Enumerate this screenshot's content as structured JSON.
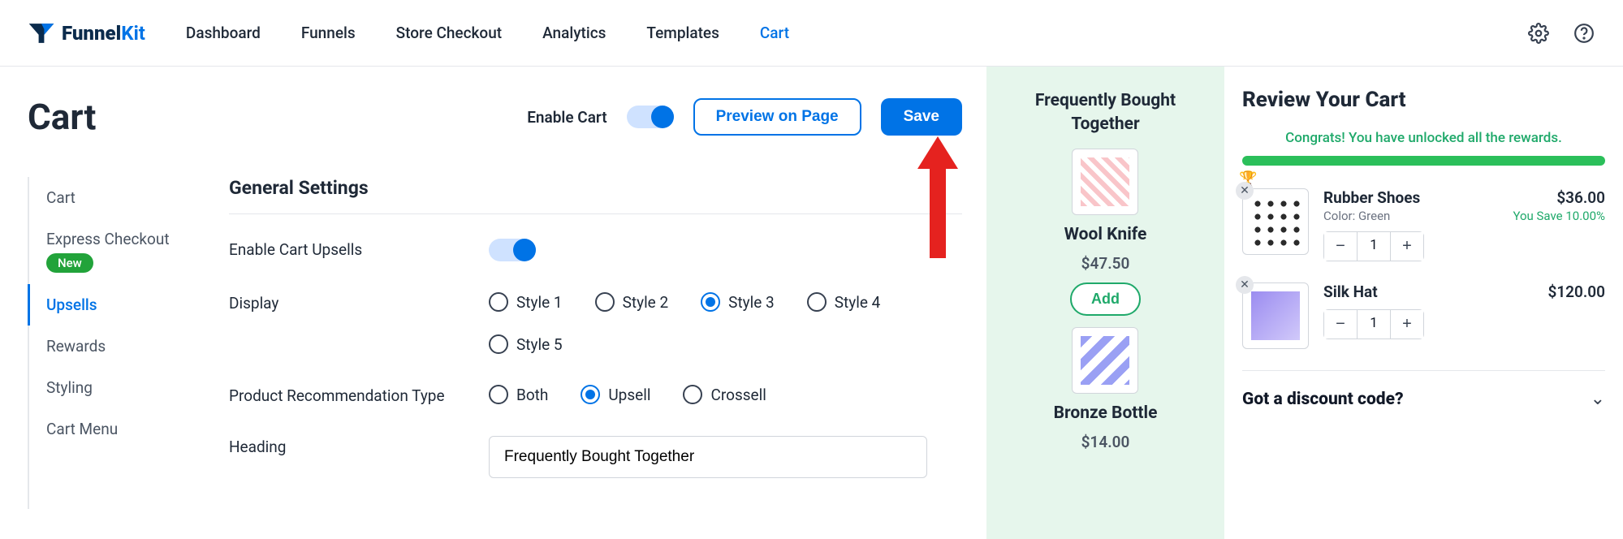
{
  "brand": {
    "name1": "Funnel",
    "name2": "Kit"
  },
  "nav": {
    "dashboard": "Dashboard",
    "funnels": "Funnels",
    "store_checkout": "Store Checkout",
    "analytics": "Analytics",
    "templates": "Templates",
    "cart": "Cart"
  },
  "page_title": "Cart",
  "enable_cart_label": "Enable Cart",
  "preview_label": "Preview on Page",
  "save_label": "Save",
  "sidebar": {
    "cart": "Cart",
    "express": "Express Checkout",
    "new_badge": "New",
    "upsells": "Upsells",
    "rewards": "Rewards",
    "styling": "Styling",
    "cart_menu": "Cart Menu"
  },
  "settings": {
    "heading": "General Settings",
    "enable_upsells": "Enable Cart Upsells",
    "display": "Display",
    "styles": {
      "s1": "Style 1",
      "s2": "Style 2",
      "s3": "Style 3",
      "s4": "Style 4",
      "s5": "Style 5"
    },
    "rec_type_label": "Product Recommendation Type",
    "rec_types": {
      "both": "Both",
      "upsell": "Upsell",
      "crossell": "Crossell"
    },
    "heading_label": "Heading",
    "heading_value": "Frequently Bought Together"
  },
  "fbt": {
    "title": "Frequently Bought Together",
    "p1_name": "Wool Knife",
    "p1_price": "$47.50",
    "add_label": "Add",
    "p2_name": "Bronze Bottle",
    "p2_price": "$14.00"
  },
  "cart": {
    "title": "Review Your Cart",
    "congrats": "Congrats! You have unlocked all the rewards.",
    "item1_name": "Rubber Shoes",
    "item1_meta": "Color: Green",
    "item1_price": "$36.00",
    "item1_save": "You Save 10.00%",
    "item1_qty": "1",
    "item2_name": "Silk Hat",
    "item2_price": "$120.00",
    "item2_qty": "1",
    "discount": "Got a discount code?"
  }
}
